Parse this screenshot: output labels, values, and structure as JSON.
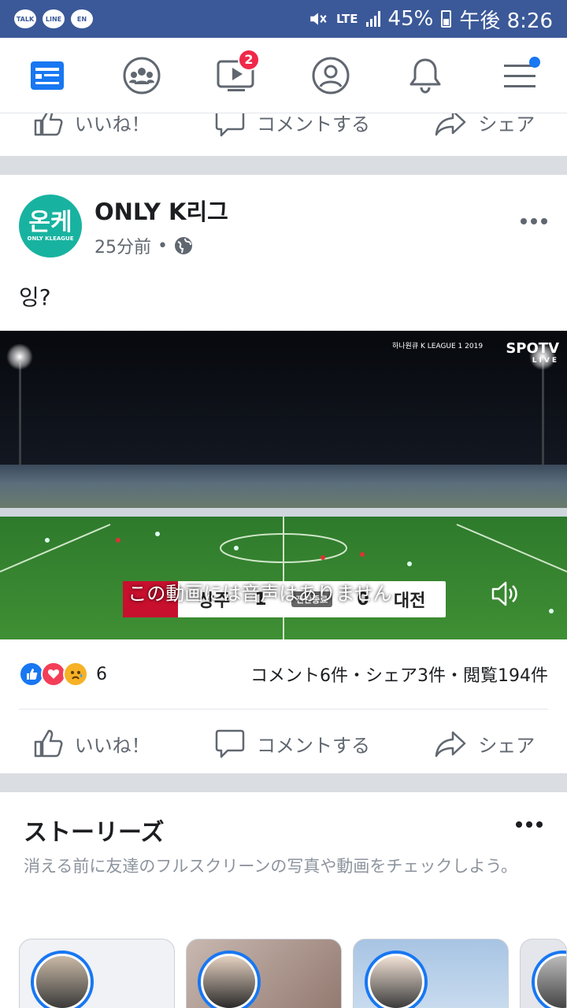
{
  "status_bar": {
    "app_badges": [
      "TALK",
      "LINE",
      "EN"
    ],
    "network": "LTE",
    "battery": "45%",
    "time": "午後 8:26"
  },
  "nav": {
    "watch_badge": "2"
  },
  "prev_post_actions": {
    "like": "いいね！",
    "comment": "コメントする",
    "share": "シェア"
  },
  "post": {
    "page_name": "ONLY K리그",
    "avatar_text": "온케",
    "avatar_subtext": "ONLY KLEAGUE",
    "time": "25分前",
    "separator": "•",
    "text": "잉?",
    "video": {
      "broadcaster": "SPOTV",
      "broadcaster_sub": "LIVE",
      "league_caption": "하나원큐 K LEAGUE 1 2019",
      "home_team": "상주",
      "home_score": "1",
      "status": "전반종료",
      "away_score": "0",
      "away_team": "대전",
      "mute_caption": "この動画には音声はありません"
    },
    "reaction_count": "6",
    "stats": "コメント6件・シェア3件・閲覧194件",
    "actions": {
      "like": "いいね！",
      "comment": "コメントする",
      "share": "シェア"
    }
  },
  "stories": {
    "title": "ストーリーズ",
    "subtitle": "消える前に友達のフルスクリーンの写真や動画をチェックしよう。"
  }
}
